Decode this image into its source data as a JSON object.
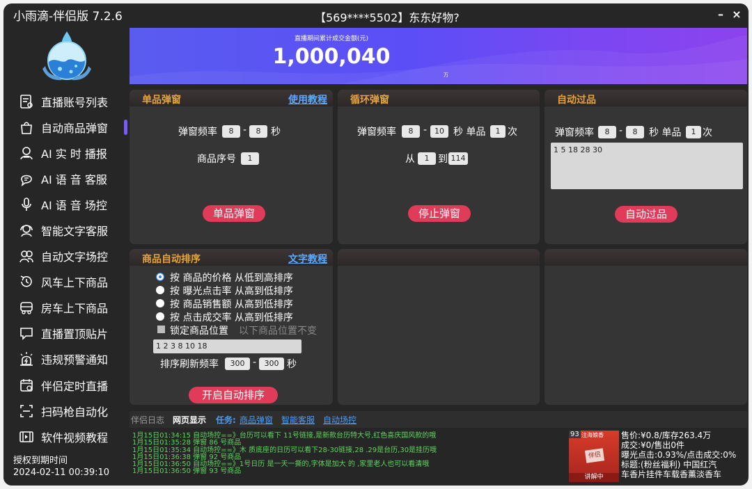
{
  "window": {
    "app_title": "小雨滴-伴侣版 7.2.6",
    "title": "【569****5502】东东好物?",
    "minimize": "–",
    "close": "×"
  },
  "sidebar": {
    "items": [
      {
        "label": "直播账号列表",
        "icon": "list-icon"
      },
      {
        "label": "自动商品弹窗",
        "icon": "bag-icon"
      },
      {
        "label": "AI 实 时 播报",
        "icon": "broadcast-person-icon"
      },
      {
        "label": "AI 语 音 客服",
        "icon": "voice-chat-icon"
      },
      {
        "label": "AI 语 音 场控",
        "icon": "microphone-icon"
      },
      {
        "label": "智能文字客服",
        "icon": "headset-icon"
      },
      {
        "label": "自动文字场控",
        "icon": "users-icon"
      },
      {
        "label": "风车上下商品",
        "icon": "refresh-clock-icon"
      },
      {
        "label": "房车上下商品",
        "icon": "rv-icon"
      },
      {
        "label": "直播置顶贴片",
        "icon": "chat-pin-icon"
      },
      {
        "label": "违规预警通知",
        "icon": "alarm-icon"
      },
      {
        "label": "伴侣定时直播",
        "icon": "calendar-icon"
      },
      {
        "label": "扫码枪自动化",
        "icon": "scan-icon"
      },
      {
        "label": "软件视频教程",
        "icon": "video-icon"
      }
    ],
    "active_index": 1,
    "license_label": "授权到期时间",
    "license_date": "2024-02-11 00:39:10"
  },
  "banner": {
    "label": "直播期间累计成交金额(元)",
    "amount": "1,000,040",
    "unit": "万"
  },
  "single_popup": {
    "title": "单品弹窗",
    "link": "使用教程",
    "freq_label": "弹窗频率",
    "freq_from": "8",
    "dash": "-",
    "freq_to": "8",
    "sec": "秒",
    "index_label": "商品序号",
    "index_value": "1",
    "button": "单品弹窗"
  },
  "loop_popup": {
    "title": "循环弹窗",
    "freq_label": "弹窗频率",
    "freq_from": "8",
    "dash": "-",
    "freq_to": "10",
    "sec_single": "秒 单品",
    "times_value": "1",
    "times": "次",
    "from_label": "从",
    "from_value": "1",
    "to_label": "到",
    "to_value": "114",
    "button": "停止弹窗"
  },
  "auto_pass": {
    "title": "自动过品",
    "freq_label": "弹窗频率",
    "freq_from": "8",
    "dash": "-",
    "freq_to": "8",
    "sec_single": "秒 单品",
    "times_value": "1",
    "times": "次",
    "textarea": "1 5 18 28 30",
    "button": "自动过品"
  },
  "auto_sort": {
    "title": "商品自动排序",
    "link": "文字教程",
    "options": [
      {
        "prefix": "按 ",
        "field": "商品的价格",
        "order": " 从低到高排序",
        "selected": true
      },
      {
        "prefix": "按 ",
        "field": "曝光点击率",
        "order": " 从高到低排序",
        "selected": false
      },
      {
        "prefix": "按 ",
        "field": "商品销售额",
        "order": " 从高到低排序",
        "selected": false
      },
      {
        "prefix": "按 ",
        "field": "点击成交率",
        "order": " 从高到低排序",
        "selected": false
      }
    ],
    "lock_label": "锁定商品位置",
    "lock_hint": "以下商品位置不变",
    "lock_input": "1 2 3 8 10 18",
    "refresh_label": "排序刷新频率",
    "refresh_from": "300",
    "dash": "-",
    "refresh_to": "300",
    "sec": "秒",
    "button": "开启自动排序"
  },
  "log_tabs": {
    "log": "伴侣日志",
    "web": "网页显示",
    "tasks_label": "任务:",
    "task1": "商品弹窗",
    "task2": "智能客服",
    "task3": "自动场控"
  },
  "log_lines": [
    "1月15日01:34:15 自动场控==》台历可以看下 11号链接,是新款台历特大号,红色喜庆国风款的哦",
    "1月15日01:35:28 弹窗 86 号商品",
    "1月15日01:35:34 自动场控==》木  质底座的日历可以看下28-30链接,28 .29是台历,30是挂历哦",
    "1月15日01:36:38 弹窗 92 号商品",
    "1月15日01:36:50 自动场控==》1号日历 是一天一撕的,字体是加大 的 ,家里老人也可以看清哦",
    "1月15日01:36:50 弹窗 93 号商品"
  ],
  "product": {
    "badge_num": "93",
    "badge_text": "注海娘香",
    "thumb_text": "伴侣",
    "live_tag": "讲解中",
    "price": "售价:¥0.8/库存263.4万",
    "deal": "成交:¥0/售出0件",
    "ctr": "曝光点击:0.93%/点击成交:0%",
    "title_line1": "标题:(粉丝福利) 中国红汽",
    "title_line2": "车香片挂件车载香薰淡香车"
  }
}
